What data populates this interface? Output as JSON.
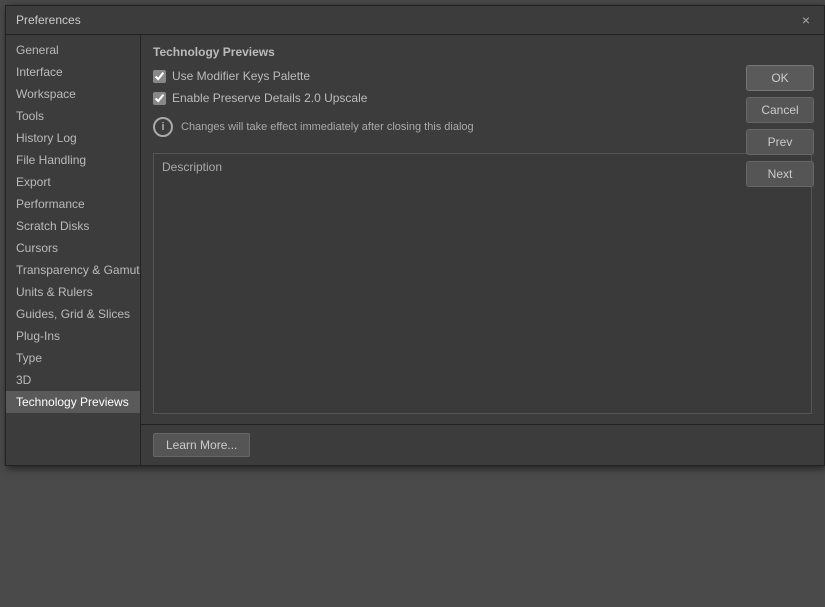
{
  "dialog": {
    "title": "Preferences",
    "close_label": "×"
  },
  "sidebar": {
    "items": [
      {
        "label": "General",
        "active": false
      },
      {
        "label": "Interface",
        "active": false
      },
      {
        "label": "Workspace",
        "active": false
      },
      {
        "label": "Tools",
        "active": false
      },
      {
        "label": "History Log",
        "active": false
      },
      {
        "label": "File Handling",
        "active": false
      },
      {
        "label": "Export",
        "active": false
      },
      {
        "label": "Performance",
        "active": false
      },
      {
        "label": "Scratch Disks",
        "active": false
      },
      {
        "label": "Cursors",
        "active": false
      },
      {
        "label": "Transparency & Gamut",
        "active": false
      },
      {
        "label": "Units & Rulers",
        "active": false
      },
      {
        "label": "Guides, Grid & Slices",
        "active": false
      },
      {
        "label": "Plug-Ins",
        "active": false
      },
      {
        "label": "Type",
        "active": false
      },
      {
        "label": "3D",
        "active": false
      },
      {
        "label": "Technology Previews",
        "active": true
      }
    ]
  },
  "main": {
    "section_title": "Technology Previews",
    "checkbox1_label": "Use Modifier Keys Palette",
    "checkbox2_label": "Enable Preserve Details 2.0 Upscale",
    "info_text": "Changes will take effect immediately after closing this dialog",
    "info_icon": "i",
    "description_label": "Description"
  },
  "buttons": {
    "ok": "OK",
    "cancel": "Cancel",
    "prev": "Prev",
    "next": "Next",
    "learn_more": "Learn More..."
  }
}
